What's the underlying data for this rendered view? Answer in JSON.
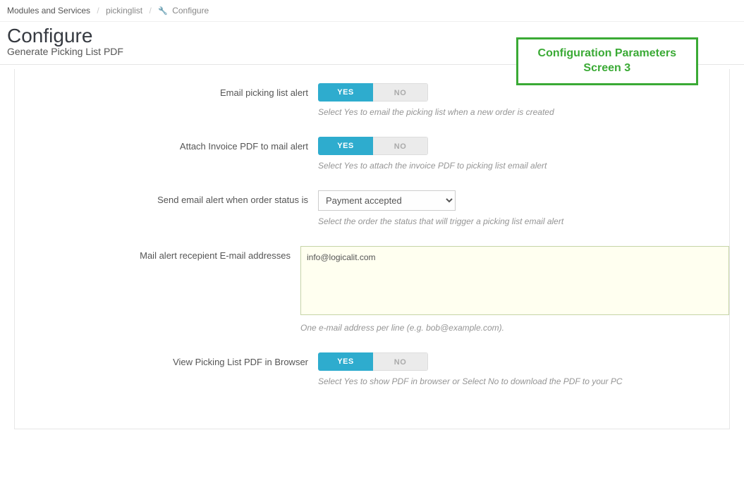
{
  "breadcrumb": {
    "root": "Modules and Services",
    "mid": "pickinglist",
    "leaf": "Configure"
  },
  "header": {
    "title": "Configure",
    "subtitle": "Generate Picking List PDF"
  },
  "callout": {
    "line1": "Configuration Parameters",
    "line2": "Screen 3"
  },
  "toggle_labels": {
    "yes": "YES",
    "no": "NO"
  },
  "fields": {
    "email_alert": {
      "label": "Email picking list alert",
      "help": "Select Yes to email the picking list when a new order is created"
    },
    "attach_invoice": {
      "label": "Attach Invoice PDF to mail alert",
      "help": "Select Yes to attach the invoice PDF to picking list email alert"
    },
    "order_status": {
      "label": "Send email alert when order status is",
      "selected": "Payment accepted",
      "help": "Select the order the status that will trigger a picking list email alert"
    },
    "recipients": {
      "label": "Mail alert recepient E-mail addresses",
      "value": "info@logicalit.com",
      "help": "One e-mail address per line (e.g. bob@example.com)."
    },
    "view_browser": {
      "label": "View Picking List PDF in Browser",
      "help": "Select Yes to show PDF in browser or Select No to download the PDF to your PC"
    }
  }
}
